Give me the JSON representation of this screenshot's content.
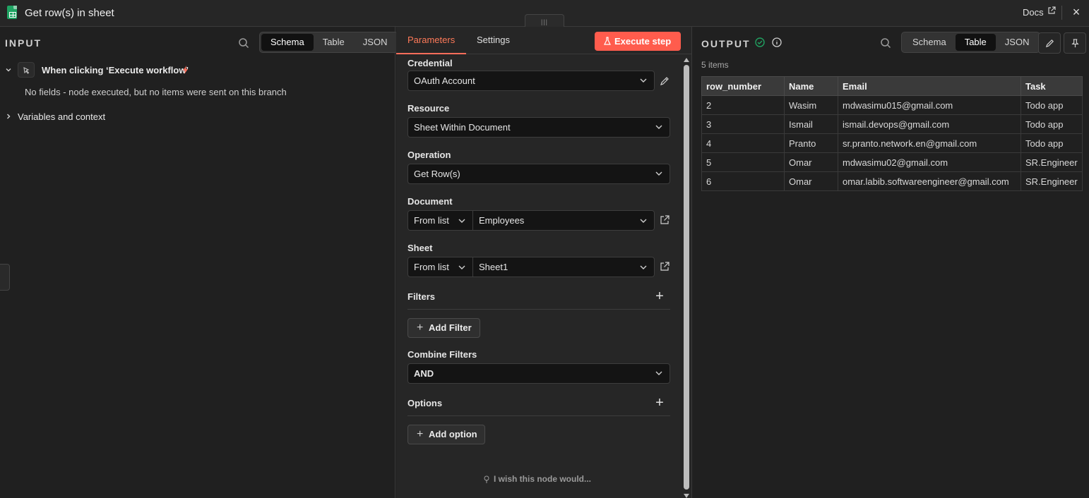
{
  "header": {
    "title": "Get row(s) in sheet",
    "docs_label": "Docs"
  },
  "input": {
    "label": "INPUT",
    "view_tabs": [
      "Schema",
      "Table",
      "JSON"
    ],
    "active_view": "Schema",
    "trigger_label": "When clicking ‘Execute workflow’",
    "no_fields_message": "No fields - node executed, but no items were sent on this branch",
    "variables_label": "Variables and context"
  },
  "params": {
    "tabs": [
      "Parameters",
      "Settings"
    ],
    "active_tab": "Parameters",
    "execute_label": "Execute step",
    "credential": {
      "label": "Credential",
      "value": "OAuth Account"
    },
    "resource": {
      "label": "Resource",
      "value": "Sheet Within Document"
    },
    "operation": {
      "label": "Operation",
      "value": "Get Row(s)"
    },
    "document": {
      "label": "Document",
      "mode": "From list",
      "value": "Employees"
    },
    "sheet": {
      "label": "Sheet",
      "mode": "From list",
      "value": "Sheet1"
    },
    "filters": {
      "label": "Filters",
      "add_label": "Add Filter"
    },
    "combine_filters": {
      "label": "Combine Filters",
      "value": "AND"
    },
    "options": {
      "label": "Options",
      "add_label": "Add option"
    },
    "wish_label": "I wish this node would..."
  },
  "output": {
    "label": "OUTPUT",
    "view_tabs": [
      "Schema",
      "Table",
      "JSON"
    ],
    "active_view": "Table",
    "items_count": "5 items",
    "columns": [
      "row_number",
      "Name",
      "Email",
      "Task"
    ],
    "rows": [
      [
        "2",
        "Wasim",
        "mdwasimu015@gmail.com",
        "Todo app"
      ],
      [
        "3",
        "Ismail",
        "ismail.devops@gmail.com",
        "Todo app"
      ],
      [
        "4",
        "Pranto",
        "sr.pranto.network.en@gmail.com",
        "Todo app"
      ],
      [
        "5",
        "Omar",
        "mdwasimu02@gmail.com",
        "SR.Engineer"
      ],
      [
        "6",
        "Omar",
        "omar.labib.softwareengineer@gmail.com",
        "SR.Engineer"
      ]
    ]
  },
  "colors": {
    "accent": "#ff6d5a",
    "success": "#20a060",
    "sheets_green": "#1fa463"
  }
}
